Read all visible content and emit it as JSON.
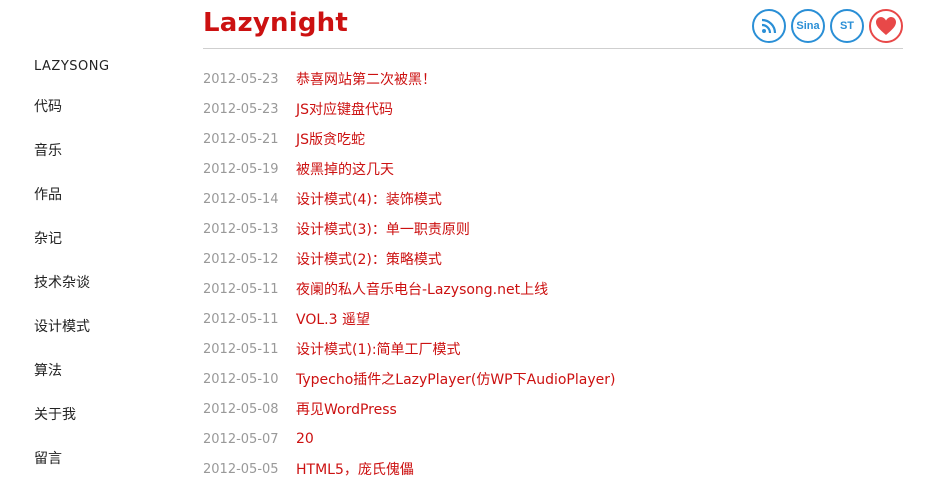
{
  "header": {
    "site_title": "Lazynight",
    "social": [
      {
        "name": "rss",
        "label": ""
      },
      {
        "name": "sina",
        "label": "Sina"
      },
      {
        "name": "st",
        "label": "ST"
      },
      {
        "name": "love",
        "label": ""
      }
    ]
  },
  "sidebar": {
    "items": [
      {
        "label": "LAZYSONG"
      },
      {
        "label": "代码"
      },
      {
        "label": "音乐"
      },
      {
        "label": "作品"
      },
      {
        "label": "杂记"
      },
      {
        "label": "技术杂谈"
      },
      {
        "label": "设计模式"
      },
      {
        "label": "算法"
      },
      {
        "label": "关于我"
      },
      {
        "label": "留言"
      }
    ]
  },
  "posts": [
    {
      "date": "2012-05-23",
      "title": "恭喜网站第二次被黑！"
    },
    {
      "date": "2012-05-23",
      "title": "JS对应键盘代码"
    },
    {
      "date": "2012-05-21",
      "title": "JS版贪吃蛇"
    },
    {
      "date": "2012-05-19",
      "title": "被黑掉的这几天"
    },
    {
      "date": "2012-05-14",
      "title": "设计模式(4)：装饰模式"
    },
    {
      "date": "2012-05-13",
      "title": "设计模式(3)：单一职责原则"
    },
    {
      "date": "2012-05-12",
      "title": "设计模式(2)：策略模式"
    },
    {
      "date": "2012-05-11",
      "title": "夜阑的私人音乐电台-Lazysong.net上线"
    },
    {
      "date": "2012-05-11",
      "title": "VOL.3 遥望"
    },
    {
      "date": "2012-05-11",
      "title": "设计模式(1):简单工厂模式"
    },
    {
      "date": "2012-05-10",
      "title": "Typecho插件之LazyPlayer(仿WP下AudioPlayer)"
    },
    {
      "date": "2012-05-08",
      "title": "再见WordPress"
    },
    {
      "date": "2012-05-07",
      "title": "20"
    },
    {
      "date": "2012-05-05",
      "title": "HTML5，庞氏傀儡"
    }
  ],
  "colors": {
    "accent": "#cc1111",
    "date": "#999999",
    "social": "#2a8fd6",
    "love": "#e84848"
  }
}
